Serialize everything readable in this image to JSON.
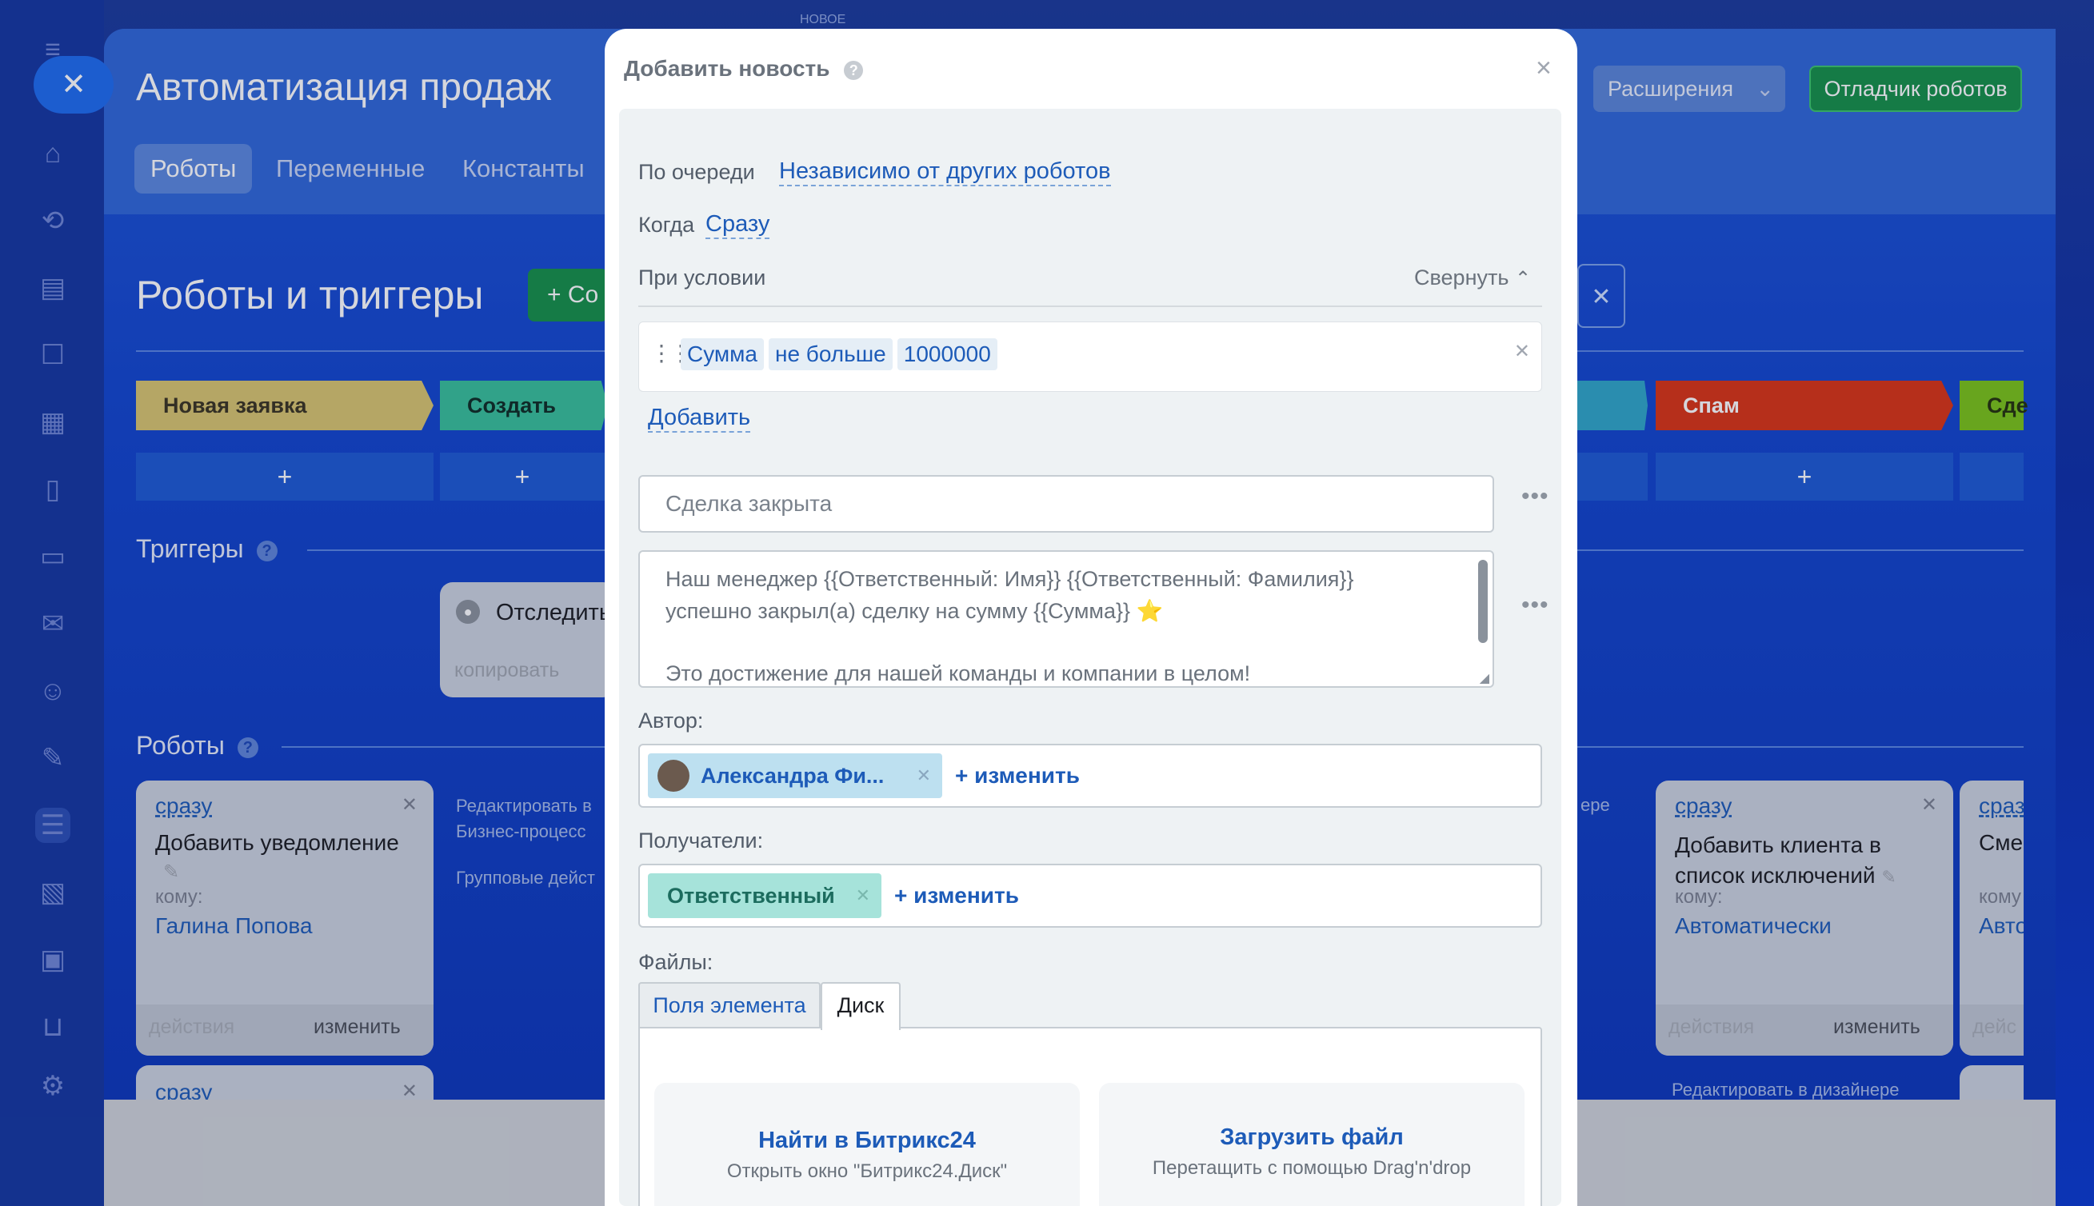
{
  "app": {
    "new_badge": "НОВОЕ",
    "page_title": "Автоматизация продаж",
    "tabs": [
      "Роботы",
      "Переменные",
      "Константы"
    ],
    "extensions_label": "Расширения",
    "debugger_label": "Отладчик роботов",
    "section_title": "Роботы и триггеры",
    "create_label": "+ Со",
    "stages": [
      {
        "label": "Новая заявка",
        "color": "#d8c56e"
      },
      {
        "label": "Создать счет",
        "color": "#37c09a"
      },
      {
        "label": "Спам",
        "color": "#d93414"
      },
      {
        "label": "Сде",
        "color": "#7bc418"
      }
    ],
    "plus": "+",
    "triggers_title": "Триггеры",
    "robots_title": "Роботы",
    "trigger_card": {
      "label": "Отследить",
      "copy": "копировать"
    },
    "left_robot": {
      "when": "сразу",
      "title": "Добавить уведомление",
      "to_label": "кому:",
      "to_value": "Галина Попова",
      "actions": "действия",
      "edit": "изменить"
    },
    "left_robot2_when": "сразу",
    "middle_text": {
      "edit_in": "Редактировать в",
      "bp": "Бизнес-процесс",
      "group": "Групповые дейст"
    },
    "right_robot": {
      "when": "сразу",
      "title": "Добавить клиента в список исключений",
      "to_label": "кому:",
      "to_value": "Автоматически",
      "actions": "действия",
      "edit": "изменить",
      "edit_in_designer": "Редактировать в дизайнере",
      "ere": "ере"
    },
    "far_right_robot": {
      "when": "сраз",
      "title": "Сме",
      "to_label": "кому",
      "to_value": "Авто",
      "actions": "дейс"
    }
  },
  "modal": {
    "title": "Добавить новость",
    "close": "×",
    "queue_label": "По очереди",
    "queue_value": "Независимо от других роботов",
    "when_label": "Когда",
    "when_value": "Сразу",
    "condition_label": "При условии",
    "collapse_label": "Свернуть",
    "condition": {
      "field": "Сумма",
      "operator": "не больше",
      "value": "1000000"
    },
    "add_label": "Добавить",
    "subject_value": "Сделка закрыта",
    "message_line1": "Наш менеджер {{Ответственный: Имя}} {{Ответственный: Фамилия}}",
    "message_line2": "успешно закрыл(а) сделку на сумму {{Сумма}} ⭐",
    "message_line3": "Это достижение для нашей команды и компании в целом!",
    "author_label": "Автор:",
    "author_value": "Александра Фи...",
    "change_label": "+ изменить",
    "recipients_label": "Получатели:",
    "recipient_value": "Ответственный",
    "files_label": "Файлы:",
    "file_tabs": [
      "Поля элемента",
      "Диск"
    ],
    "find_title": "Найти в Битрикс24",
    "find_sub": "Открыть окно \"Битрикс24.Диск\"",
    "upload_title": "Загрузить файл",
    "upload_sub": "Перетащить с помощью Drag'n'drop"
  }
}
